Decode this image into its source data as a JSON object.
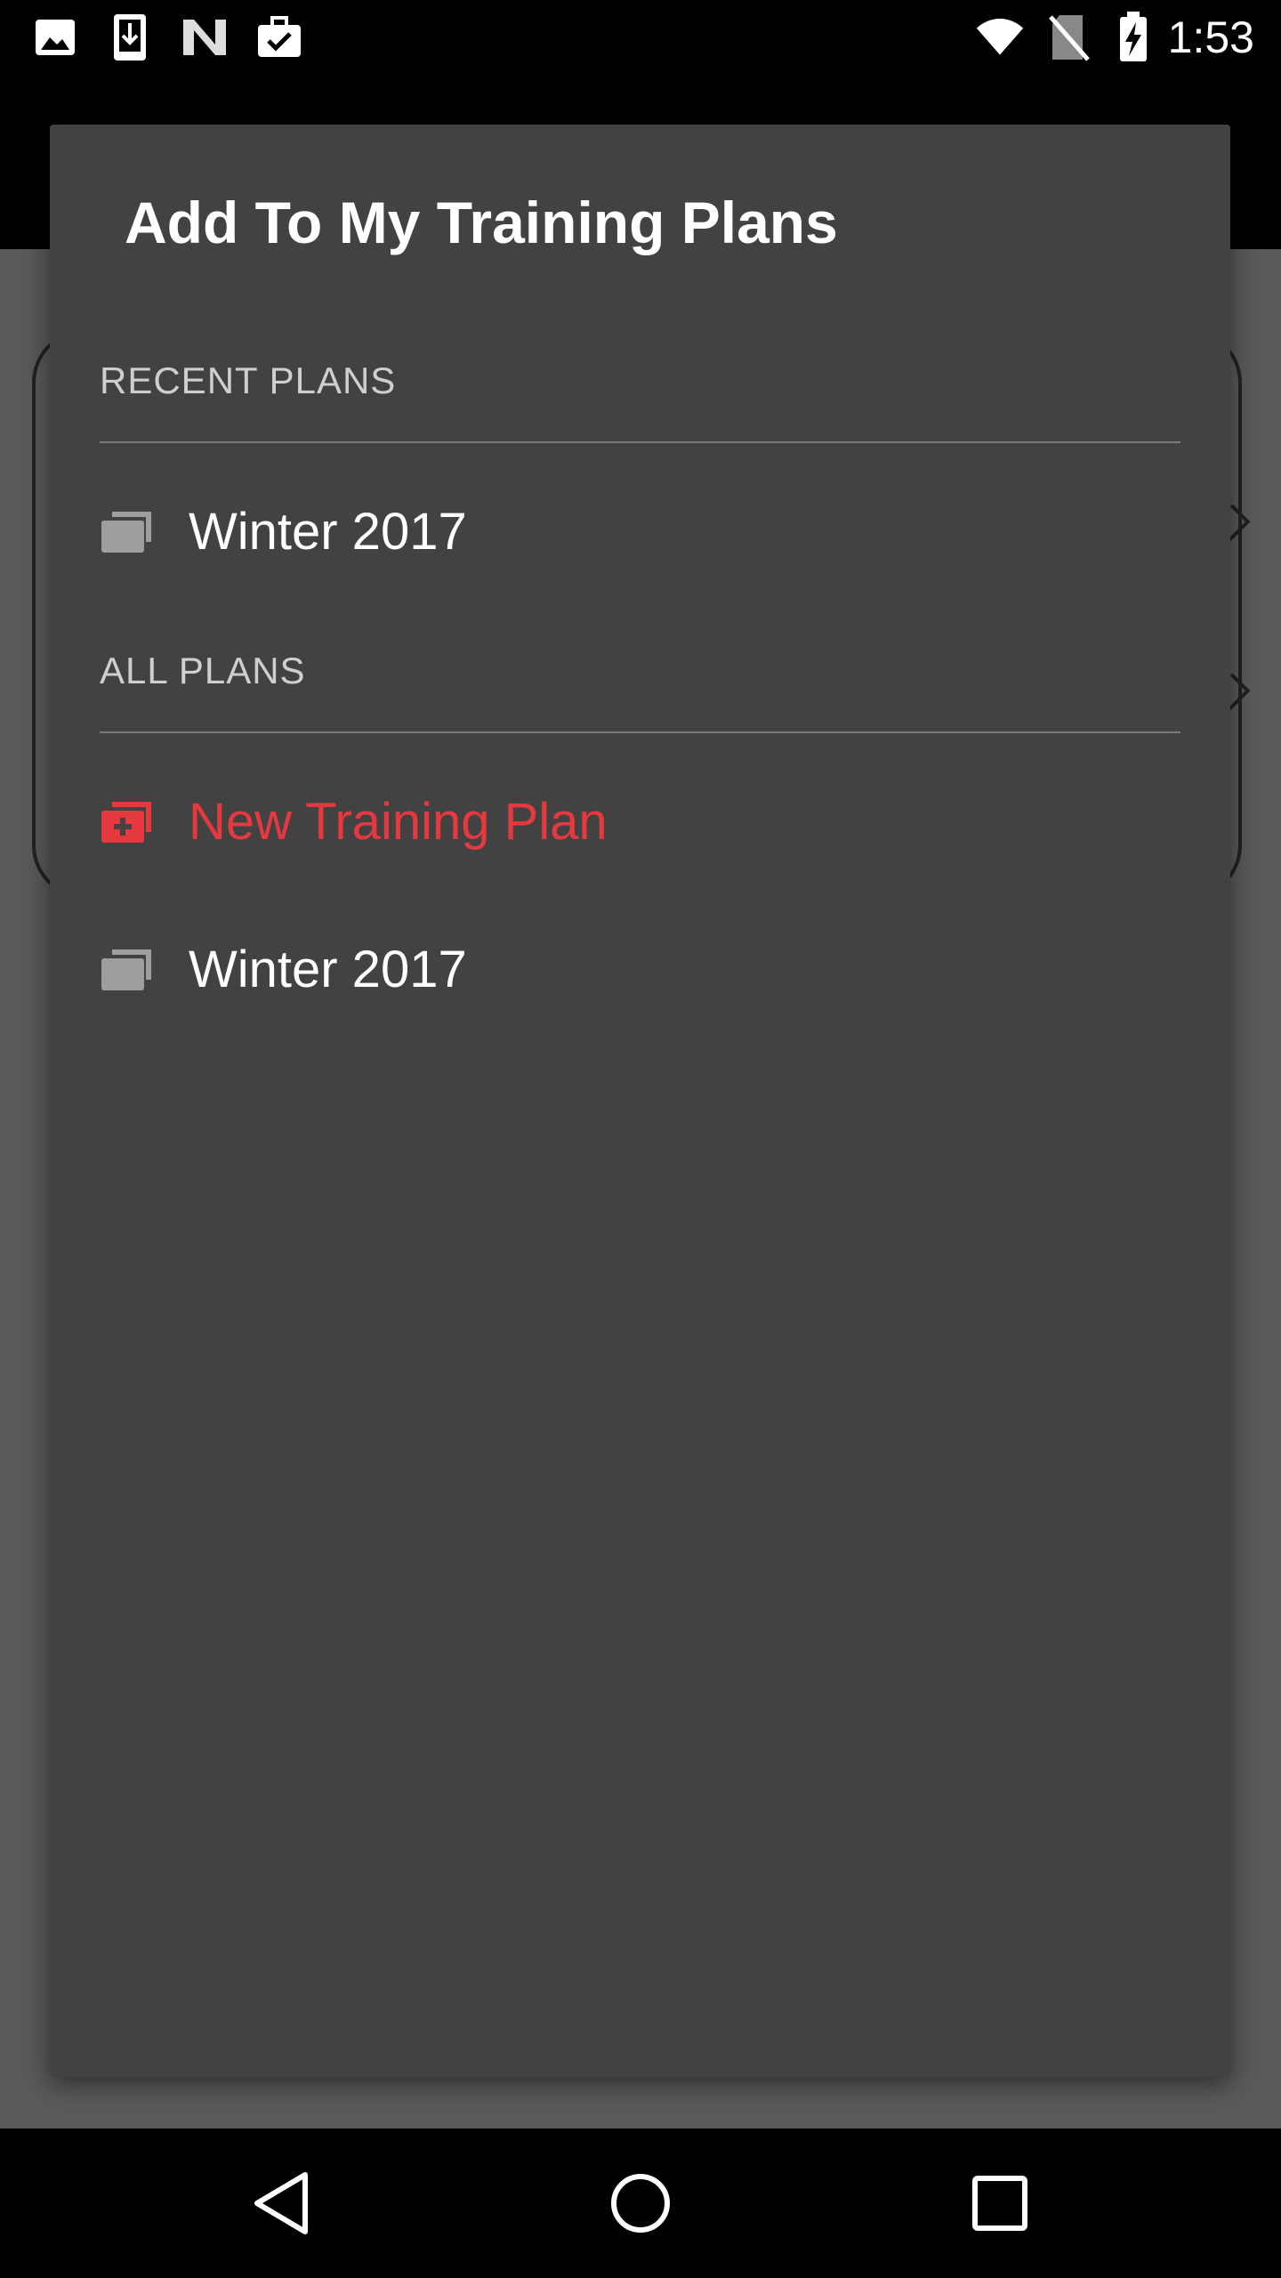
{
  "status_bar": {
    "time": "1:53",
    "left_icons": [
      "image-icon",
      "download-icon",
      "n-logo-icon",
      "briefcase-check-icon"
    ],
    "right_icons": [
      "wifi-icon",
      "no-sim-icon",
      "battery-charging-icon"
    ]
  },
  "dialog": {
    "title": "Add To My Training Plans",
    "recent_header": "RECENT PLANS",
    "recent_items": [
      {
        "label": "Winter 2017",
        "icon": "stacked-folders-icon"
      }
    ],
    "all_header": "ALL PLANS",
    "all_items": [
      {
        "label": "New Training Plan",
        "icon": "add-plan-icon",
        "accent": true
      },
      {
        "label": "Winter 2017",
        "icon": "stacked-folders-icon"
      }
    ]
  },
  "colors": {
    "dialog_bg": "#424242",
    "accent": "#e5393f",
    "text": "#ffffff",
    "header_text": "#cfcfcf"
  },
  "nav_bar": {
    "buttons": [
      "back-icon",
      "home-icon",
      "recents-icon"
    ]
  }
}
